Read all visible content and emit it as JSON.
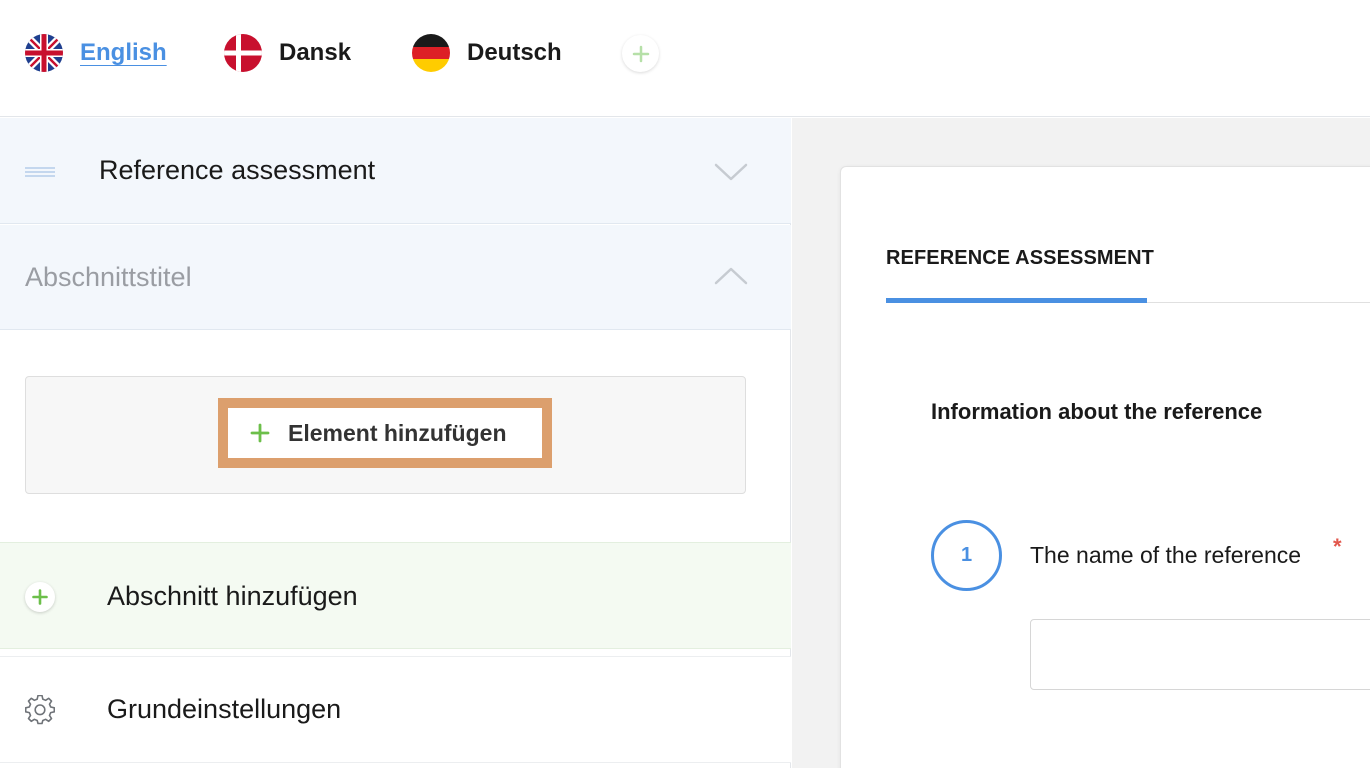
{
  "languages": [
    {
      "label": "English",
      "active": true,
      "flag": "uk-flag-icon"
    },
    {
      "label": "Dansk",
      "active": false,
      "flag": "denmark-flag-icon"
    },
    {
      "label": "Deutsch",
      "active": false,
      "flag": "germany-flag-icon"
    }
  ],
  "sidebar": {
    "section_title": "Reference assessment",
    "subsection_title": "Abschnittstitel",
    "add_element_label": "Element hinzufügen",
    "add_section_label": "Abschnitt hinzufügen",
    "settings_label": "Grundeinstellungen"
  },
  "preview": {
    "tab_title": "REFERENCE ASSESSMENT",
    "section_heading": "Information about the reference",
    "question_number": "1",
    "question_text": "The name of the reference",
    "required_mark": "*"
  },
  "colors": {
    "accent_blue": "#4a90e2",
    "plus_green": "#6cbf4a",
    "highlight_orange": "#dc9f6d",
    "required_red": "#e2574c"
  }
}
